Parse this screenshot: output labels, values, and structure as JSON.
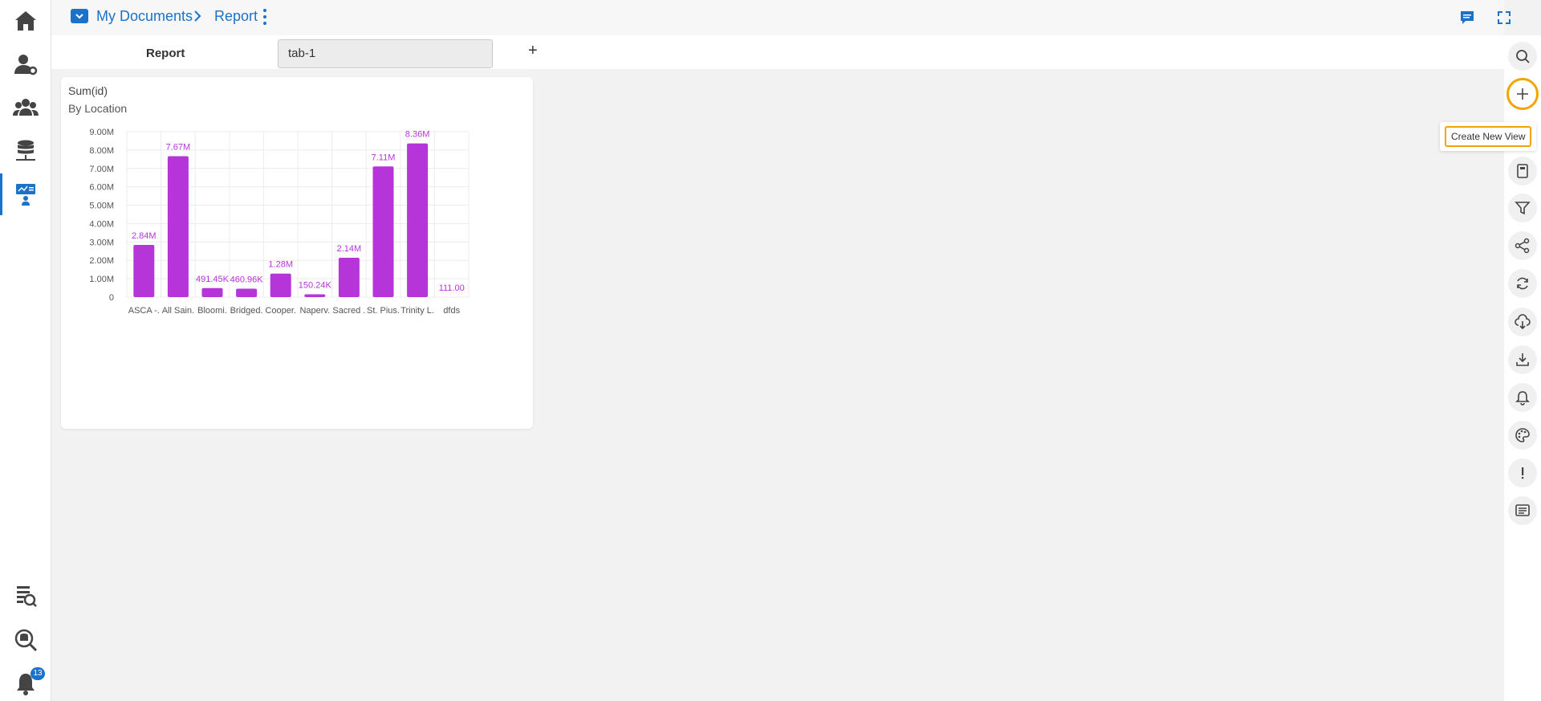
{
  "colors": {
    "accent": "#1a73c8",
    "bar": "#b535d9",
    "highlight": "#f0a500",
    "icon": "#444444"
  },
  "breadcrumb": {
    "folder_icon": "folder-icon",
    "root": "My Documents",
    "current": "Report"
  },
  "sidebar": {
    "items": [
      {
        "icon": "home-icon"
      },
      {
        "icon": "user-settings-icon"
      },
      {
        "icon": "users-group-icon"
      },
      {
        "icon": "database-icon"
      },
      {
        "icon": "dashboard-designer-icon",
        "active": true
      },
      {
        "icon": "data-search-icon"
      },
      {
        "icon": "search-db-icon"
      },
      {
        "icon": "bell-icon"
      }
    ],
    "notification_count": "13"
  },
  "tabs": {
    "section_label": "Report",
    "items": [
      "tab-1"
    ],
    "add_label": "+"
  },
  "card": {
    "title": "Sum(id)",
    "subtitle": "By Location"
  },
  "chart_data": {
    "type": "bar",
    "title": "Sum(id)",
    "subtitle": "By Location",
    "categories": [
      "ASCA -.",
      "All Sain.",
      "Bloomi.",
      "Bridged.",
      "Cooper.",
      "Naperv.",
      "Sacred .",
      "St. Pius.",
      "Trinity L.",
      "dfds"
    ],
    "values": [
      2840000,
      7670000,
      491450,
      460960,
      1280000,
      150240,
      2140000,
      7110000,
      8360000,
      111
    ],
    "data_labels": [
      "2.84M",
      "7.67M",
      "491.45K",
      "460.96K",
      "1.28M",
      "150.24K",
      "2.14M",
      "7.11M",
      "8.36M",
      "111.00"
    ],
    "y_ticks": [
      0,
      1000000,
      2000000,
      3000000,
      4000000,
      5000000,
      6000000,
      7000000,
      8000000,
      9000000
    ],
    "y_tick_labels": [
      "0",
      "1.00M",
      "2.00M",
      "3.00M",
      "4.00M",
      "5.00M",
      "6.00M",
      "7.00M",
      "8.00M",
      "9.00M"
    ],
    "ylim": [
      0,
      9000000
    ],
    "grid": true,
    "xlabel": "",
    "ylabel": ""
  },
  "right_toolbar": {
    "items": [
      {
        "icon": "search-icon"
      },
      {
        "icon": "plus-icon",
        "highlighted": true
      },
      {
        "icon": "layers-icon"
      },
      {
        "icon": "notebook-icon"
      },
      {
        "icon": "filter-icon"
      },
      {
        "icon": "share-icon"
      },
      {
        "icon": "refresh-icon"
      },
      {
        "icon": "cloud-download-icon"
      },
      {
        "icon": "download-icon"
      },
      {
        "icon": "bell-icon"
      },
      {
        "icon": "palette-icon"
      },
      {
        "icon": "info-icon"
      },
      {
        "icon": "comments-icon"
      }
    ],
    "tooltip": "Create New View"
  },
  "top_icons": {
    "comment": "comment-icon",
    "fullscreen": "fullscreen-icon"
  }
}
